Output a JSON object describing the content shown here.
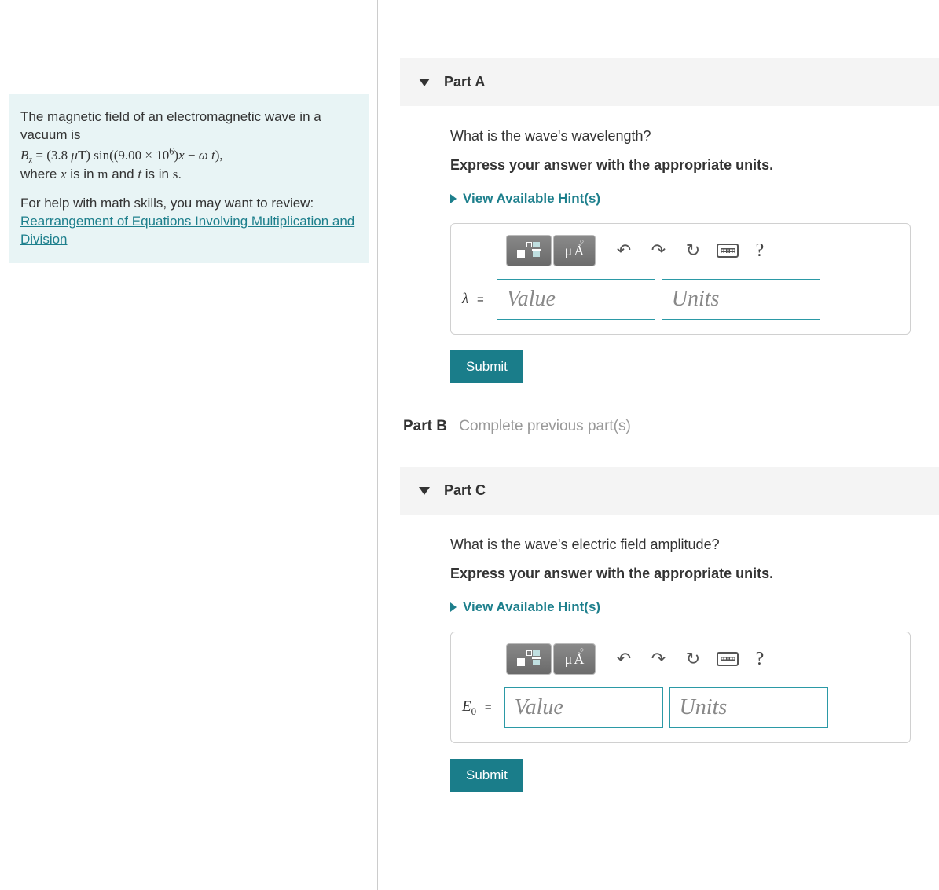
{
  "problem": {
    "intro_1": "The magnetic field of an electromagnetic wave in a vacuum is",
    "eq_lhs_var": "B",
    "eq_lhs_sub": "z",
    "eq_eqsign": " = ",
    "eq_amp": "(3.8 ",
    "eq_mu": "μ",
    "eq_unit": "T) ",
    "eq_sin": "sin",
    "eq_k1": "((9.00 × 10",
    "eq_kexp": "6",
    "eq_k2": ")",
    "eq_x": "x",
    "eq_minus": "  −  ",
    "eq_omega": "ω ",
    "eq_t": "t",
    "eq_close": "),",
    "where_1": "where ",
    "where_x": "x",
    "where_2": " is in ",
    "where_m": "m",
    "where_3": " and ",
    "where_t": "t",
    "where_4": " is in ",
    "where_s": "s",
    "where_5": ".",
    "help_intro": "For help with math skills, you may want to review:",
    "help_link": "Rearrangement of Equations Involving Multiplication and Division"
  },
  "partA": {
    "title": "Part A",
    "question": "What is the wave's wavelength?",
    "instruction": "Express your answer with the appropriate units.",
    "hints": "View Available Hint(s)",
    "variable": "λ",
    "eq": "=",
    "value_placeholder": "Value",
    "units_placeholder": "Units",
    "submit": "Submit"
  },
  "partB": {
    "label": "Part B",
    "msg": "Complete previous part(s)"
  },
  "partC": {
    "title": "Part C",
    "question": "What is the wave's electric field amplitude?",
    "instruction": "Express your answer with the appropriate units.",
    "hints": "View Available Hint(s)",
    "variable": "E",
    "variable_sub": "0",
    "eq": "=",
    "value_placeholder": "Value",
    "units_placeholder": "Units",
    "submit": "Submit"
  },
  "toolbar": {
    "symbols_label_mu": "μ",
    "symbols_label_A": "Å",
    "undo": "↶",
    "redo": "↷",
    "reset": "↻",
    "help": "?"
  }
}
